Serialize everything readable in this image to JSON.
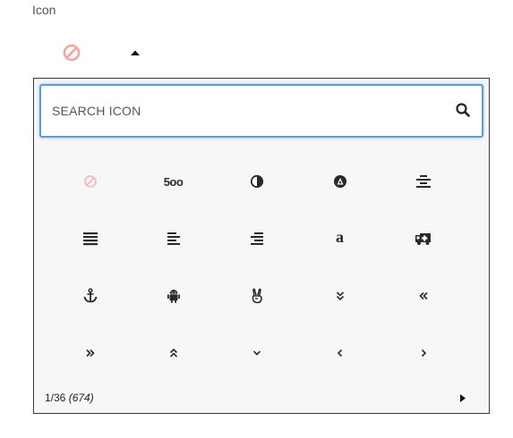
{
  "field": {
    "label": "Icon"
  },
  "selected_icon": {
    "name": "ban-icon",
    "color": "#f28b8b"
  },
  "search": {
    "placeholder": "SEARCH ICON",
    "value": ""
  },
  "icons": [
    {
      "name": "ban-icon"
    },
    {
      "name": "500px-icon",
      "text": "5oo"
    },
    {
      "name": "adjust-icon"
    },
    {
      "name": "adn-icon"
    },
    {
      "name": "align-center-icon"
    },
    {
      "name": "align-justify-icon"
    },
    {
      "name": "align-left-icon"
    },
    {
      "name": "align-right-icon"
    },
    {
      "name": "amazon-icon",
      "text": "a"
    },
    {
      "name": "ambulance-icon"
    },
    {
      "name": "anchor-icon",
      "text": "⚓"
    },
    {
      "name": "android-icon"
    },
    {
      "name": "angellist-icon",
      "text": "✌"
    },
    {
      "name": "angle-double-down-icon",
      "text": "»"
    },
    {
      "name": "angle-double-left-icon",
      "text": "«"
    },
    {
      "name": "angle-double-right-icon",
      "text": "»"
    },
    {
      "name": "angle-double-up-icon",
      "text": "«"
    },
    {
      "name": "angle-down-icon",
      "text": "⌄"
    },
    {
      "name": "angle-left-icon",
      "text": "‹"
    },
    {
      "name": "angle-right-icon",
      "text": "›"
    }
  ],
  "pagination": {
    "current": "1/36",
    "total": "(674)"
  },
  "colors": {
    "accent": "#5b9be0",
    "selected": "#f28b8b",
    "icon": "#2a2a2a"
  }
}
